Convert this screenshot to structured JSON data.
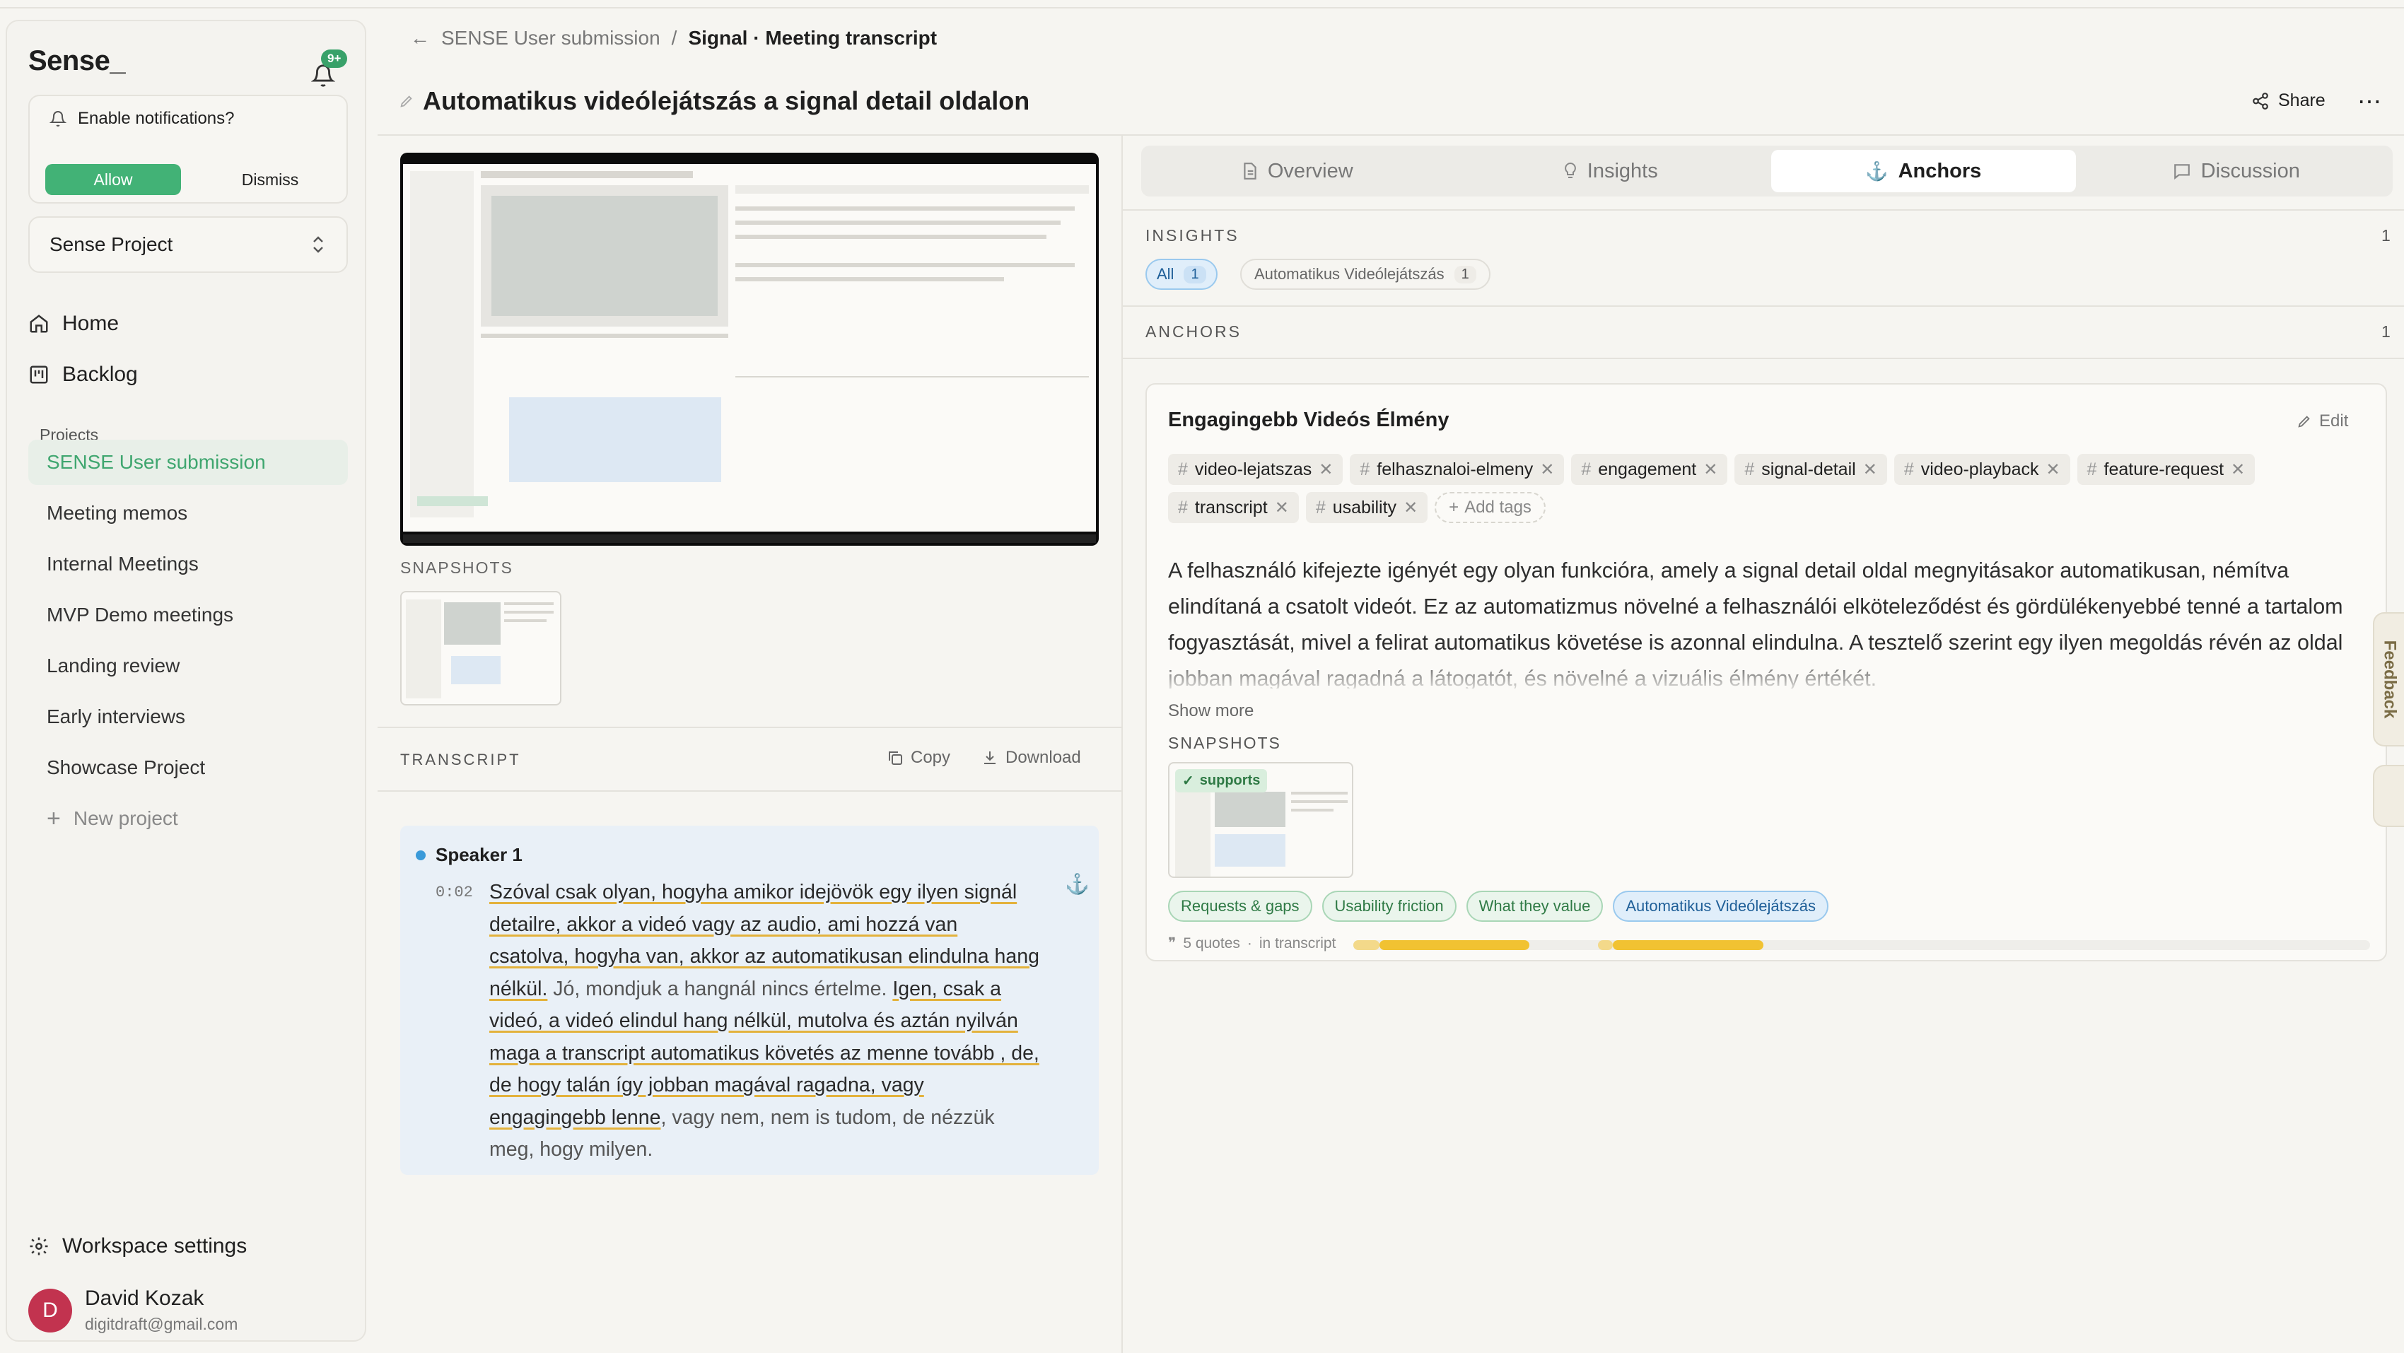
{
  "app": {
    "brand": "Sense_",
    "notification_badge": "9+"
  },
  "notification_prompt": {
    "title": "Enable notifications?",
    "allow": "Allow",
    "dismiss": "Dismiss"
  },
  "project_selector": {
    "value": "Sense Project"
  },
  "nav": {
    "home": "Home",
    "backlog": "Backlog"
  },
  "projects": {
    "label": "Projects",
    "items": [
      "SENSE User submission",
      "Meeting memos",
      "Internal Meetings",
      "MVP Demo meetings",
      "Landing review",
      "Early interviews",
      "Showcase Project"
    ],
    "active_index": 0,
    "new_label": "New project"
  },
  "footer": {
    "workspace_settings": "Workspace settings",
    "user_name": "David Kozak",
    "user_email": "digitdraft@gmail.com",
    "avatar_initial": "D"
  },
  "breadcrumb": {
    "parent": "SENSE User submission",
    "separator": "/",
    "current": "Signal · Meeting transcript"
  },
  "page": {
    "title": "Automatikus videólejátszás a signal detail oldalon",
    "share": "Share"
  },
  "media": {
    "snapshots_label": "SNAPSHOTS"
  },
  "transcript": {
    "label": "TRANSCRIPT",
    "copy": "Copy",
    "download": "Download",
    "speaker": "Speaker 1",
    "time": "0:02",
    "segments": [
      {
        "text": "Szóval csak olyan, hogyha  amikor idejövök egy ilyen signál detailre, akkor a videó vagy az audio, ami hozzá van csatolva, hogyha van, akkor az automatikusan elindulna hang nélkül.",
        "highlight": true
      },
      {
        "text": " Jó, mondjuk a hangnál nincs értelme. ",
        "highlight": false
      },
      {
        "text": "Igen, csak a videó,  a videó elindul hang nélkül, mutolva és aztán nyilván maga a transcript automatikus követés az menne tovább , de,  de hogy talán így jobban magával ragadna, vagy engagingebb lenne",
        "highlight": true
      },
      {
        "text": ", vagy nem, nem is tudom, de nézzük meg, hogy milyen.",
        "highlight": false
      }
    ]
  },
  "tabs": [
    {
      "label": "Overview",
      "icon": "document-icon"
    },
    {
      "label": "Insights",
      "icon": "lightbulb-icon"
    },
    {
      "label": "Anchors",
      "icon": "anchor-icon",
      "active": true
    },
    {
      "label": "Discussion",
      "icon": "chat-icon"
    }
  ],
  "insights": {
    "label": "INSIGHTS",
    "count": "1",
    "all_label": "All",
    "all_count": "1",
    "chip_label": "Automatikus Videólejátszás",
    "chip_count": "1"
  },
  "anchors": {
    "label": "ANCHORS",
    "count": "1"
  },
  "anchor_card": {
    "title": "Engagingebb Videós Élmény",
    "edit": "Edit",
    "tags": [
      "video-lejatszas",
      "felhasznaloi-elmeny",
      "engagement",
      "signal-detail",
      "video-playback",
      "feature-request",
      "transcript",
      "usability"
    ],
    "add_tags": "Add tags",
    "description": "A felhasználó kifejezte igényét egy olyan funkcióra, amely a signal detail oldal megnyitásakor automatikusan, némítva elindítaná a csatolt videót. Ez az automatizmus növelné a felhasználói elköteleződést és gördülékenyebbé tenné a tartalom fogyasztását, mivel a felirat automatikus követése is azonnal elindulna. A tesztelő szerint egy ilyen megoldás révén az oldal jobban magával ragadná a látogatót, és növelné a vizuális élmény értékét.",
    "show_more": "Show more",
    "snapshots_label": "SNAPSHOTS",
    "supports_badge": "supports",
    "categories": [
      "Requests & gaps",
      "Usability friction",
      "What they value",
      "Automatikus Videólejátszás"
    ],
    "quotes": "5 quotes",
    "quotes_location": "in transcript",
    "quote_coverage": [
      {
        "start": 0.0,
        "end": 0.0255,
        "shade": "light"
      },
      {
        "start": 0.0255,
        "end": 0.1735,
        "shade": "strong"
      },
      {
        "start": 0.2405,
        "end": 0.2555,
        "shade": "light"
      },
      {
        "start": 0.2555,
        "end": 0.4035,
        "shade": "strong"
      }
    ]
  },
  "side_tabs": {
    "feedback": "Feedback"
  },
  "colors": {
    "accent_green": "#42b276",
    "highlight_yellow": "#f1c232",
    "speaker_blue": "#3a9ad9",
    "avatar": "#c2334f"
  }
}
